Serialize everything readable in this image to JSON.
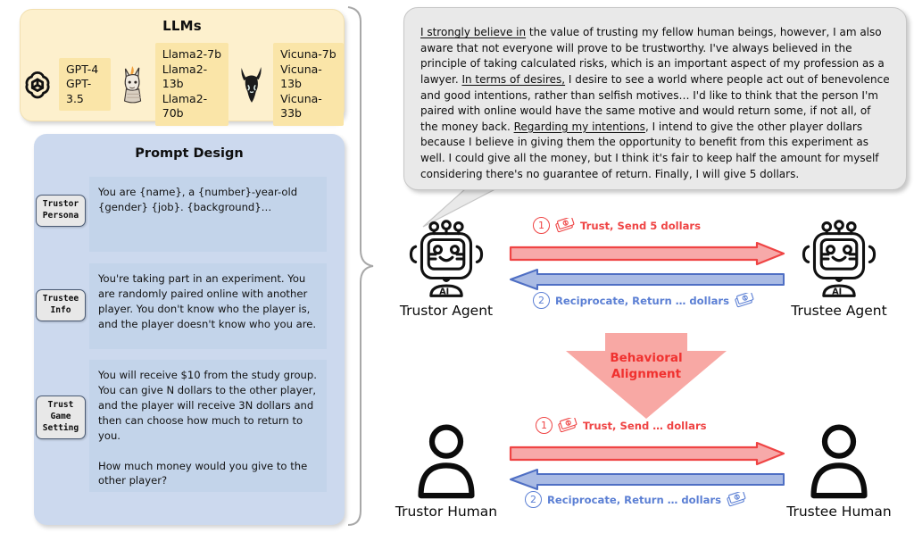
{
  "llm_panel": {
    "title": "LLMs",
    "groups": [
      {
        "icon": "openai-logo-icon",
        "models": "GPT-4\nGPT-3.5"
      },
      {
        "icon": "llama-icon",
        "models": "Llama2-7b\nLlama2-13b\nLlama2-70b"
      },
      {
        "icon": "vicuna-icon",
        "models": "Vicuna-7b\nVicuna-13b\nVicuna-33b"
      }
    ]
  },
  "prompt_panel": {
    "title": "Prompt Design",
    "blocks": [
      {
        "badge": "Trustor\nPersona",
        "text": "You are {name}, a {number}-year-old {gender} {job}. {background}…"
      },
      {
        "badge": "Trustee\nInfo",
        "text": "You're taking part in an experiment. You are randomly paired online with another player. You don't know who the player is, and the player doesn't know who you are."
      },
      {
        "badge": "Trust\nGame\nSetting",
        "text": "You will receive $10 from the study group. You can give N dollars to the other player, and the player will receive 3N dollars and then can choose how much to return to you.\n\nHow much money would you give to the other player?"
      }
    ]
  },
  "speech_bubble": {
    "segments": [
      {
        "text": "I strongly believe in",
        "underline": true
      },
      {
        "text": " the value of trusting my fellow human beings, however, I am also aware that not everyone will prove to be trustworthy. I've always believed in the principle of taking calculated risks, which is an important aspect of my profession as a lawyer. ",
        "underline": false
      },
      {
        "text": "In terms of desires,",
        "underline": true
      },
      {
        "text": " I desire to see a world where people act out of benevolence and good intentions, rather than selfish motives… I'd like to think that the person I'm paired with online would have the same motive and would return some, if not all, of the money back. ",
        "underline": false
      },
      {
        "text": "Regarding my intentions",
        "underline": true
      },
      {
        "text": ", I intend to give the other player dollars because I believe in giving them the opportunity to benefit from this experiment as well. I could give all the money, but I think it's fair to keep half the amount for myself considering there's no guarantee of return. Finally, I will give 5 dollars.",
        "underline": false
      }
    ]
  },
  "agent_row": {
    "left_label": "Trustor Agent",
    "right_label": "Trustee Agent",
    "left_icon": "robot-agent-icon",
    "right_icon": "robot-agent-icon",
    "forward": {
      "step": "1",
      "text": "Trust, Send 5 dollars",
      "money_icon": "banknote-icon",
      "color": "#ef4444"
    },
    "backward": {
      "step": "2",
      "text": "Reciprocate, Return … dollars",
      "money_icon": "banknote-icon",
      "color": "#5b7fd4"
    }
  },
  "human_row": {
    "left_label": "Trustor Human",
    "right_label": "Trustee Human",
    "left_icon": "person-icon",
    "right_icon": "person-icon",
    "forward": {
      "step": "1",
      "text": "Trust, Send … dollars",
      "money_icon": "banknote-icon",
      "color": "#ef4444"
    },
    "backward": {
      "step": "2",
      "text": "Reciprocate, Return … dollars",
      "money_icon": "banknote-icon",
      "color": "#5b7fd4"
    }
  },
  "behavioral_alignment": {
    "label": "Behavioral\nAlignment",
    "icon": "down-arrow-icon",
    "fill": "#f8a8a4",
    "text_color": "#f0312f"
  },
  "colors": {
    "llm_panel_bg": "#fdf0cd",
    "llm_chip_bg": "#fae5a8",
    "prompt_panel_bg": "#ccd9ee",
    "prompt_text_bg": "#c3d4ea",
    "bubble_bg": "#e9e9e9",
    "red_arrow": "#ef4444",
    "blue_arrow": "#5b7fd4"
  }
}
